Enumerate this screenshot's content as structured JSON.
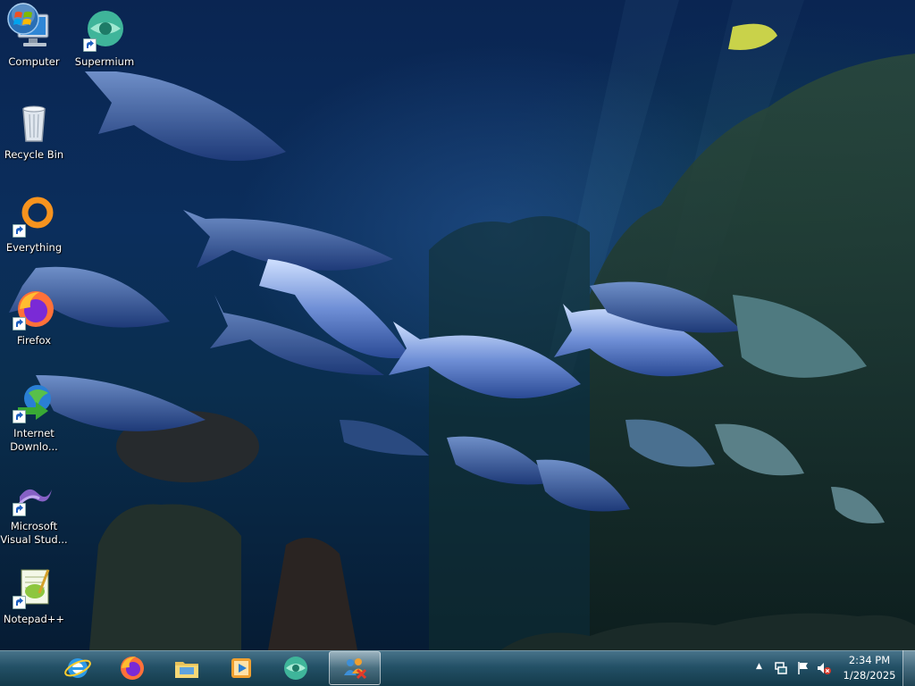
{
  "desktop": {
    "icons": [
      {
        "label": "Computer",
        "icon": "computer-icon"
      },
      {
        "label": "Supermium",
        "icon": "supermium-icon"
      },
      {
        "label": "Recycle Bin",
        "icon": "recycle-bin-icon"
      },
      {
        "label": "Everything",
        "icon": "everything-icon"
      },
      {
        "label": "Firefox",
        "icon": "firefox-icon"
      },
      {
        "label": "Internet Downlo...",
        "icon": "internet-download-manager-icon"
      },
      {
        "label": "Microsoft Visual Stud...",
        "icon": "visual-studio-icon"
      },
      {
        "label": "Notepad++",
        "icon": "notepad-plus-plus-icon"
      }
    ]
  },
  "taskbar": {
    "start": {
      "icon": "windows-start-orb-icon"
    },
    "pinned": [
      {
        "name": "internet-explorer",
        "icon": "internet-explorer-icon"
      },
      {
        "name": "firefox",
        "icon": "firefox-icon"
      },
      {
        "name": "file-explorer",
        "icon": "folder-icon"
      },
      {
        "name": "media-player",
        "icon": "media-player-icon"
      },
      {
        "name": "supermium",
        "icon": "supermium-icon"
      },
      {
        "name": "network-users",
        "icon": "network-users-icon",
        "active": true
      }
    ],
    "tray": {
      "icons": [
        "show-hidden-icons-chevron",
        "network-icon",
        "action-center-flag-icon",
        "volume-muted-icon"
      ]
    },
    "clock": {
      "time": "2:34 PM",
      "date": "1/28/2025"
    }
  },
  "colors": {
    "wallpaper_deep": "#0a2552",
    "taskbar_tint": "#2f6a7c",
    "label_text": "#ffffff"
  }
}
